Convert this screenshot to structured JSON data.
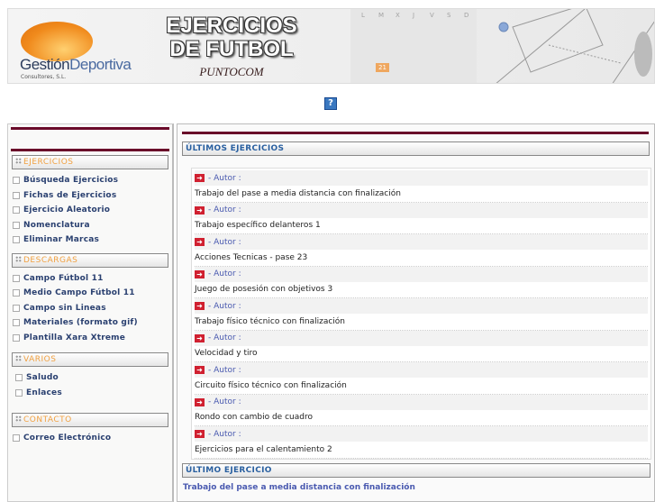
{
  "header": {
    "logo_name_1": "Gestión",
    "logo_name_2": "Deportiva",
    "logo_sub": "Consultores, S.L.",
    "title_1": "EJERCICIOS",
    "title_2": "DE FUTBOL",
    "subtitle": "PUNTOCOM",
    "calendar_days": [
      "L",
      "M",
      "X",
      "J",
      "V",
      "S",
      "D"
    ],
    "calendar_highlight": "21"
  },
  "help_label": "?",
  "sidebar": {
    "sections": [
      {
        "title": "EJERCICIOS",
        "items": [
          "Búsqueda Ejercicios",
          "Fichas de Ejercicios",
          "Ejercicio Aleatorio",
          "Nomenclatura",
          "Eliminar Marcas"
        ]
      },
      {
        "title": "DESCARGAS",
        "items": [
          "Campo Fútbol 11",
          "Medio Campo Fútbol 11",
          "Campo sin Lineas",
          "Materiales (formato gif)",
          "Plantilla Xara Xtreme"
        ]
      },
      {
        "title": "VARIOS",
        "items": [
          "Saludo",
          "Enlaces"
        ]
      },
      {
        "title": "CONTACTO",
        "items": [
          "Correo Electrónico"
        ]
      }
    ]
  },
  "main": {
    "latest_title": "ÚLTIMOS EJERCICIOS",
    "author_label": "- Autor :",
    "exercises": [
      "Trabajo del pase a media distancia con finalización",
      "Trabajo específico delanteros 1",
      "Acciones Tecnicas - pase 23",
      "Juego de posesión con objetivos 3",
      "Trabajo físico técnico con finalización",
      "Velocidad y tiro",
      "Circuito físico técnico con finalización",
      "Rondo con cambio de cuadro",
      "Ejercicios para el calentamiento 2"
    ],
    "last_title": "ÚLTIMO EJERCICIO",
    "last_link": "Trabajo del pase a media distancia con finalización"
  }
}
